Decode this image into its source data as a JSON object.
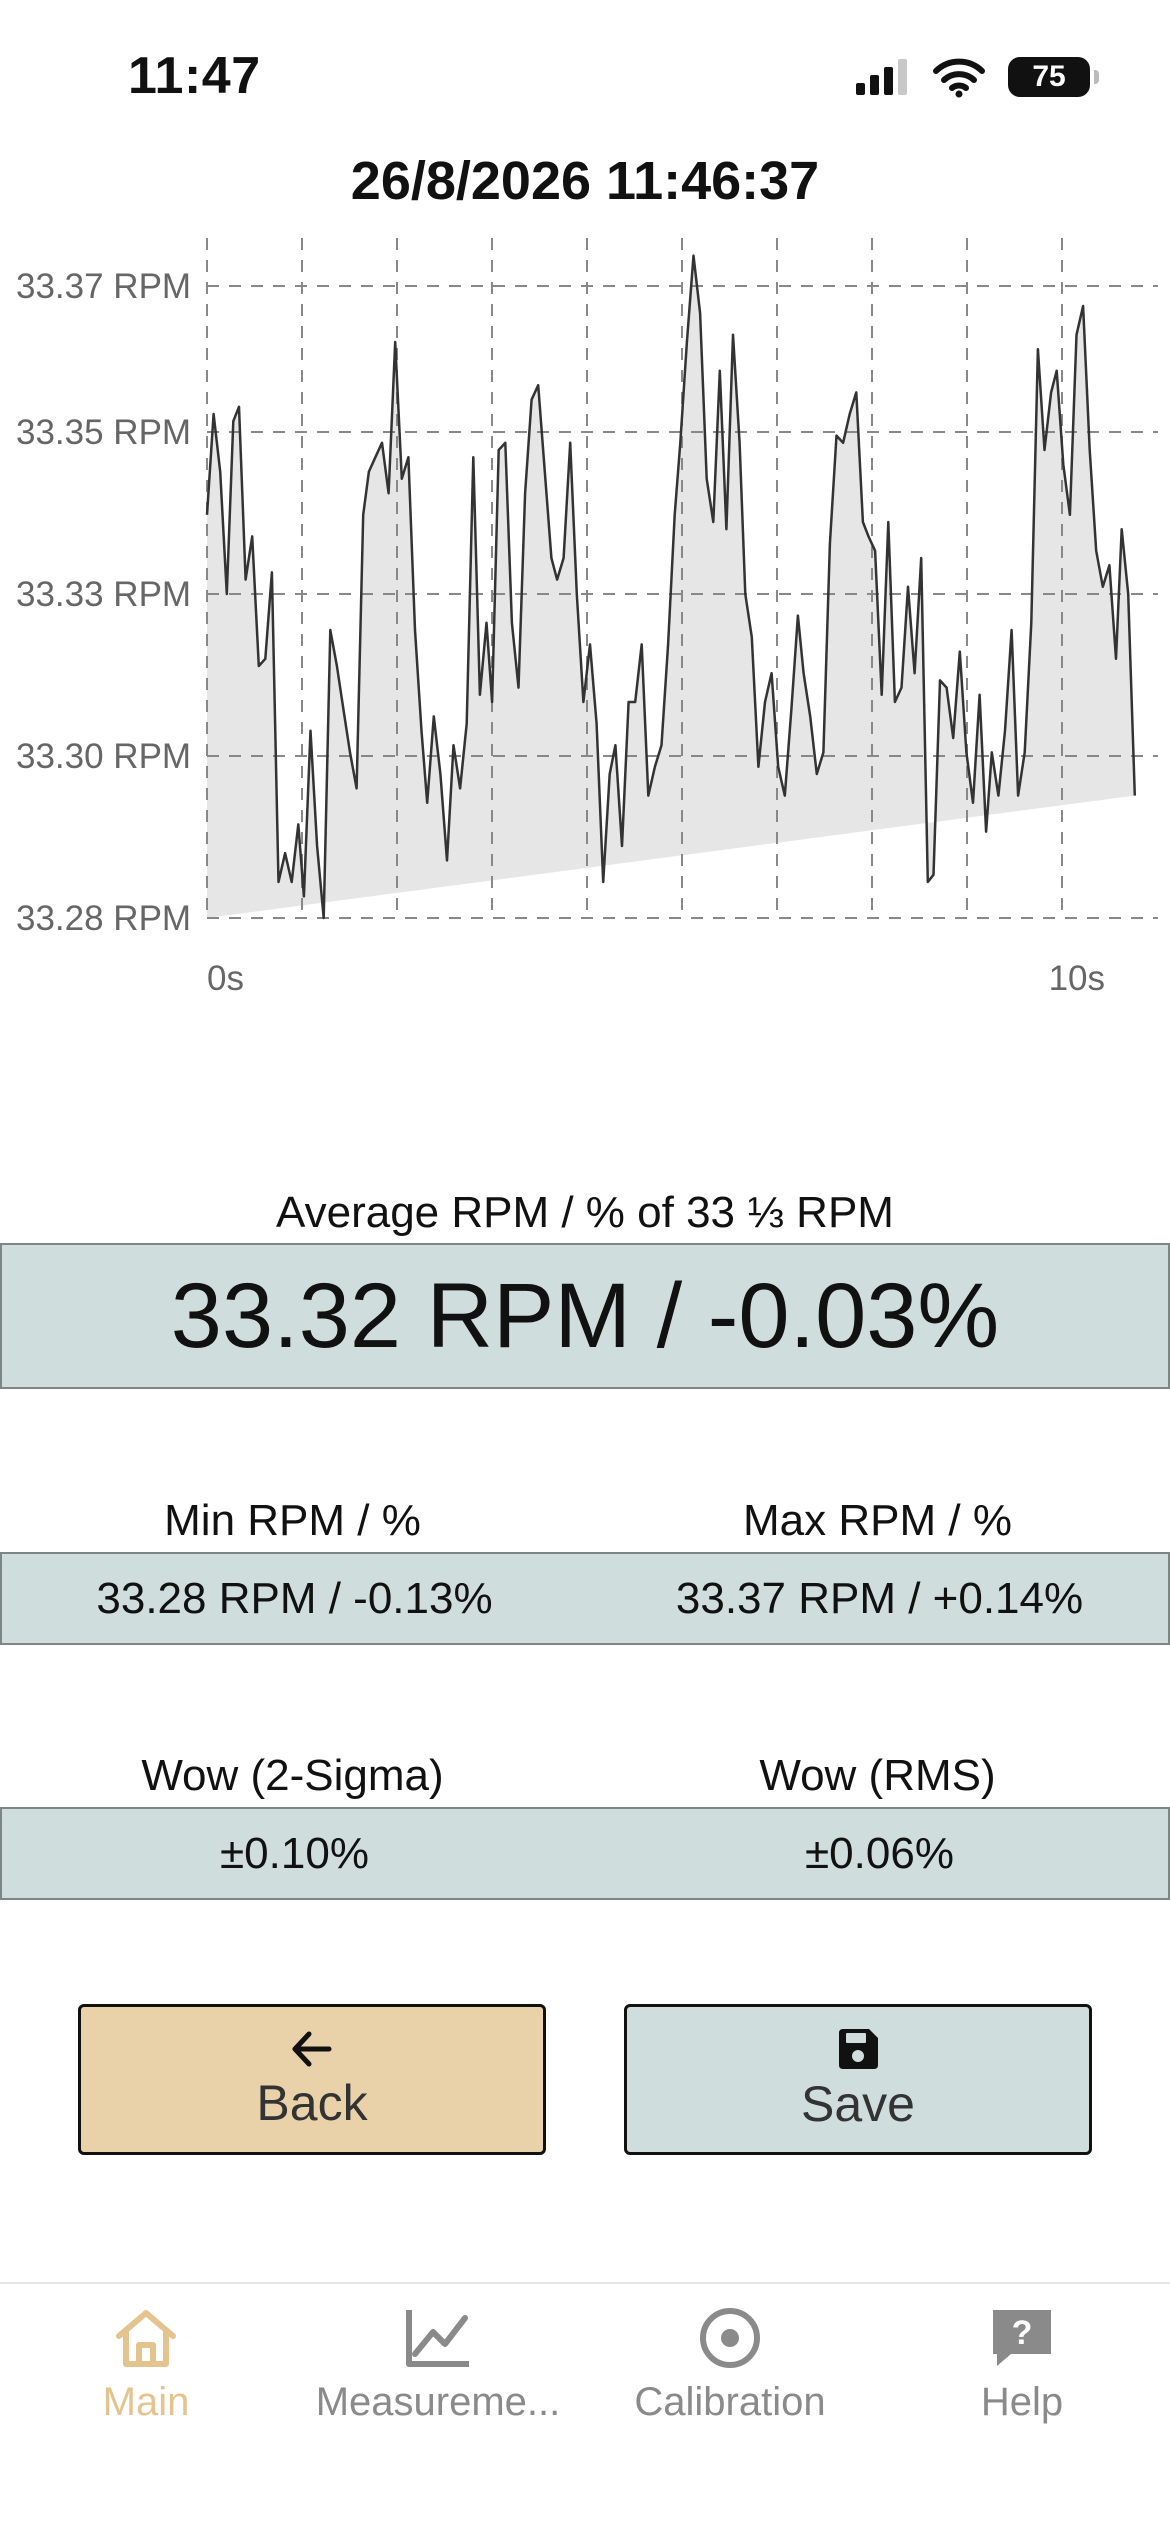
{
  "status_bar": {
    "time": "11:47",
    "battery": "75"
  },
  "chart_title": "26/8/2026 11:46:37",
  "chart_data": {
    "type": "area",
    "y_tick_labels": [
      "33.37 RPM",
      "33.35 RPM",
      "33.33 RPM",
      "33.30 RPM",
      "33.28 RPM"
    ],
    "x_tick_labels": [
      "0s",
      "10s"
    ],
    "ylim": [
      33.28,
      33.37
    ],
    "xlim": [
      0,
      10
    ],
    "grid": true,
    "fill_color": "#e6e6e6",
    "line_color": "#333333",
    "grid_color": "#888888",
    "x": [
      0.0,
      0.07,
      0.14,
      0.21,
      0.28,
      0.34,
      0.41,
      0.48,
      0.55,
      0.62,
      0.69,
      0.76,
      0.83,
      0.9,
      0.97,
      1.03,
      1.1,
      1.17,
      1.24,
      1.31,
      1.38,
      1.45,
      1.52,
      1.59,
      1.66,
      1.72,
      1.79,
      1.86,
      1.93,
      2.0,
      2.07,
      2.14,
      2.21,
      2.28,
      2.34,
      2.41,
      2.48,
      2.55,
      2.62,
      2.69,
      2.76,
      2.83,
      2.9,
      2.97,
      3.03,
      3.1,
      3.17,
      3.24,
      3.31,
      3.38,
      3.45,
      3.52,
      3.59,
      3.66,
      3.72,
      3.79,
      3.86,
      3.93,
      4.0,
      4.07,
      4.14,
      4.21,
      4.28,
      4.34,
      4.41,
      4.48,
      4.55,
      4.62,
      4.69,
      4.76,
      4.83,
      4.9,
      4.97,
      5.03,
      5.1,
      5.17,
      5.24,
      5.31,
      5.38,
      5.45,
      5.52,
      5.59,
      5.66,
      5.72,
      5.79,
      5.86,
      5.93,
      6.0,
      6.07,
      6.14,
      6.21,
      6.28,
      6.34,
      6.41,
      6.48,
      6.55,
      6.62,
      6.69,
      6.76,
      6.83,
      6.9,
      6.97,
      7.03,
      7.1,
      7.17,
      7.24,
      7.31,
      7.38,
      7.45,
      7.52,
      7.59,
      7.66,
      7.72,
      7.79,
      7.86,
      7.93,
      8.0,
      8.07,
      8.14,
      8.21,
      8.28,
      8.34,
      8.41,
      8.48,
      8.55,
      8.62,
      8.69,
      8.76,
      8.83,
      8.9,
      8.97,
      9.03,
      9.1,
      9.17,
      9.24,
      9.31,
      9.38,
      9.45,
      9.52,
      9.59,
      9.66,
      9.72,
      9.79,
      9.86,
      9.93,
      10.0
    ],
    "y": [
      33.336,
      33.35,
      33.342,
      33.325,
      33.349,
      33.351,
      33.327,
      33.333,
      33.315,
      33.316,
      33.328,
      33.285,
      33.289,
      33.285,
      33.293,
      33.283,
      33.306,
      33.29,
      33.28,
      33.32,
      33.315,
      33.309,
      33.303,
      33.298,
      33.336,
      33.342,
      33.344,
      33.346,
      33.339,
      33.36,
      33.341,
      33.344,
      33.32,
      33.306,
      33.296,
      33.308,
      33.3,
      33.288,
      33.304,
      33.298,
      33.307,
      33.344,
      33.311,
      33.321,
      33.31,
      33.345,
      33.346,
      33.321,
      33.312,
      33.339,
      33.352,
      33.354,
      33.342,
      33.33,
      33.327,
      33.33,
      33.346,
      33.325,
      33.31,
      33.318,
      33.307,
      33.285,
      33.3,
      33.304,
      33.29,
      33.31,
      33.31,
      33.318,
      33.297,
      33.301,
      33.304,
      33.318,
      33.336,
      33.346,
      33.36,
      33.372,
      33.364,
      33.341,
      33.335,
      33.356,
      33.334,
      33.361,
      33.346,
      33.325,
      33.319,
      33.301,
      33.31,
      33.314,
      33.301,
      33.297,
      33.309,
      33.322,
      33.314,
      33.308,
      33.3,
      33.303,
      33.332,
      33.347,
      33.346,
      33.35,
      33.353,
      33.335,
      33.333,
      33.331,
      33.311,
      33.335,
      33.31,
      33.312,
      33.326,
      33.314,
      33.33,
      33.285,
      33.286,
      33.313,
      33.312,
      33.305,
      33.317,
      33.303,
      33.296,
      33.311,
      33.292,
      33.303,
      33.297,
      33.306,
      33.32,
      33.297,
      33.303,
      33.321,
      33.359,
      33.345,
      33.353,
      33.356,
      33.343,
      33.336,
      33.361,
      33.365,
      33.345,
      33.331,
      33.326,
      33.329,
      33.316,
      33.334,
      33.325,
      33.297
    ]
  },
  "average": {
    "label": "Average RPM / % of 33 ⅓ RPM",
    "value": "33.32 RPM / -0.03%"
  },
  "min": {
    "label": "Min RPM / %",
    "value": "33.28 RPM / -0.13%"
  },
  "max": {
    "label": "Max RPM / %",
    "value": "33.37 RPM / +0.14%"
  },
  "wow_2sigma": {
    "label": "Wow (2-Sigma)",
    "value": "±0.10%"
  },
  "wow_rms": {
    "label": "Wow (RMS)",
    "value": "±0.06%"
  },
  "buttons": {
    "back": "Back",
    "save": "Save"
  },
  "tabs": [
    {
      "label": "Main",
      "icon": "home-icon",
      "active": true
    },
    {
      "label": "Measureme...",
      "icon": "chart-icon",
      "active": false
    },
    {
      "label": "Calibration",
      "icon": "target-icon",
      "active": false
    },
    {
      "label": "Help",
      "icon": "help-icon",
      "active": false
    }
  ],
  "colors": {
    "accent": "#e3c48e",
    "value_box": "#cfdedd",
    "back_button": "#e9d2aa",
    "inactive_tab": "#8a8a8a"
  }
}
